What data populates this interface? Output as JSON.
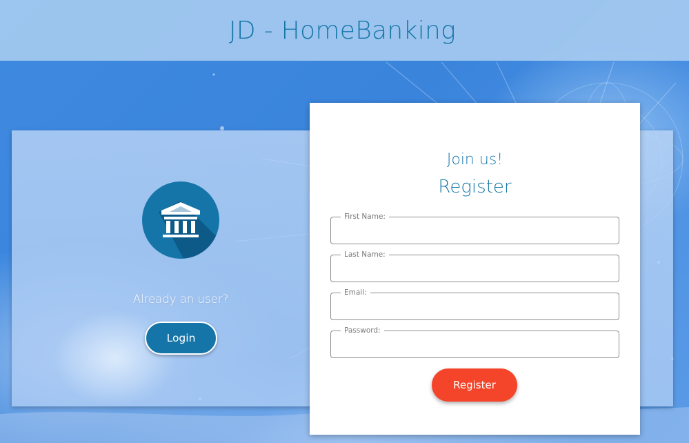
{
  "header": {
    "title": "JD - HomeBanking"
  },
  "login_panel": {
    "logo_icon": "bank-building-icon",
    "prompt": "Already an user?",
    "login_label": "Login"
  },
  "register_card": {
    "subtitle": "Join us!",
    "title": "Register",
    "fields": [
      {
        "label": "First Name:",
        "value": ""
      },
      {
        "label": "Last Name:",
        "value": ""
      },
      {
        "label": "Email:",
        "value": ""
      },
      {
        "label": "Password:",
        "value": ""
      }
    ],
    "submit_label": "Register"
  },
  "colors": {
    "brand_blue": "#1575a8",
    "register_button": "#f4452a",
    "header_bg": "#aacdf0"
  }
}
